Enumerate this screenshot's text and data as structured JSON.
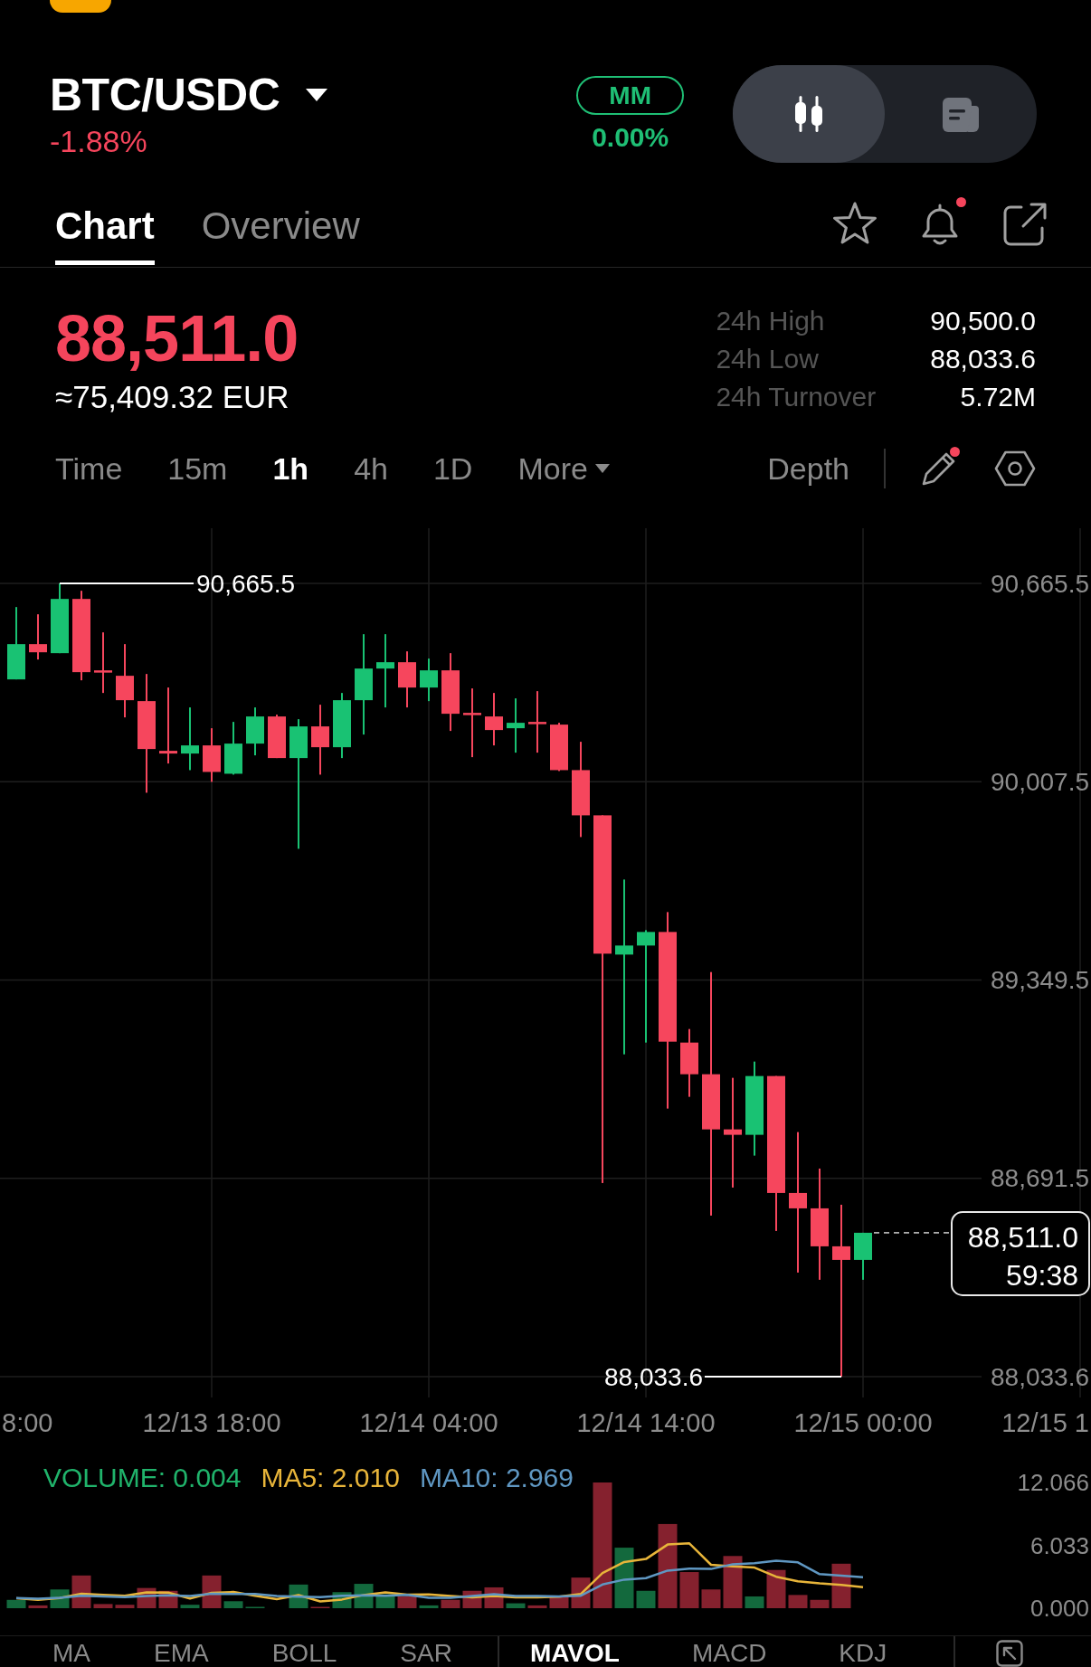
{
  "header": {
    "pair": "BTC/USDC",
    "change": "-1.88%",
    "mm": {
      "badge": "MM",
      "rate": "0.00%"
    },
    "view_toggle": [
      {
        "kind": "chart",
        "selected": true
      },
      {
        "kind": "news",
        "selected": false
      }
    ]
  },
  "tabs": [
    {
      "label": "Chart",
      "selected": true
    },
    {
      "label": "Overview",
      "selected": false
    }
  ],
  "tab_actions": [
    {
      "kind": "star",
      "dot": false
    },
    {
      "kind": "bell",
      "dot": true
    },
    {
      "kind": "share",
      "dot": false
    }
  ],
  "price": {
    "last": "88,511.0",
    "fiat": "≈75,409.32 EUR",
    "stats": [
      {
        "label": "24h High",
        "value": "90,500.0"
      },
      {
        "label": "24h Low",
        "value": "88,033.6"
      },
      {
        "label": "24h Turnover",
        "value": "5.72M"
      }
    ]
  },
  "intervals": [
    {
      "label": "Time",
      "kind": "interval",
      "selected": false
    },
    {
      "label": "15m",
      "kind": "interval",
      "selected": false
    },
    {
      "label": "1h",
      "kind": "interval",
      "selected": true
    },
    {
      "label": "4h",
      "kind": "interval",
      "selected": false
    },
    {
      "label": "1D",
      "kind": "interval",
      "selected": false
    },
    {
      "label": "More",
      "kind": "dropdown",
      "selected": false
    }
  ],
  "depth": "Depth",
  "chart_tools": [
    {
      "kind": "pencil",
      "dot": true
    },
    {
      "kind": "settings",
      "dot": false
    }
  ],
  "price_chart": {
    "price_axis": [
      "90,665.5",
      "90,007.5",
      "89,349.5",
      "88,691.5",
      "88,033.6"
    ],
    "time_axis": [
      "8:00",
      "12/13 18:00",
      "12/14 04:00",
      "12/14 14:00",
      "12/15 00:00",
      "12/15 1"
    ],
    "high_label": "90,665.5",
    "low_label": "88,033.6",
    "last_tag": {
      "price": "88,511.0",
      "countdown": "59:38"
    }
  },
  "volume_panel": {
    "legend": [
      {
        "text": "VOLUME: 0.004",
        "color": "#20b36b"
      },
      {
        "text": "MA5: 2.010",
        "color": "#e8b53a"
      },
      {
        "text": "MA10: 2.969",
        "color": "#5f97c2"
      }
    ],
    "volume_axis": [
      "12.066",
      "6.033",
      "0.000"
    ]
  },
  "indicators": {
    "main": [
      {
        "label": "MA",
        "selected": false
      },
      {
        "label": "EMA",
        "selected": false
      },
      {
        "label": "BOLL",
        "selected": false
      },
      {
        "label": "SAR",
        "selected": false
      }
    ],
    "sub": [
      {
        "label": "MAVOL",
        "selected": true
      },
      {
        "label": "MACD",
        "selected": false
      },
      {
        "label": "KDJ",
        "selected": false
      }
    ]
  }
}
